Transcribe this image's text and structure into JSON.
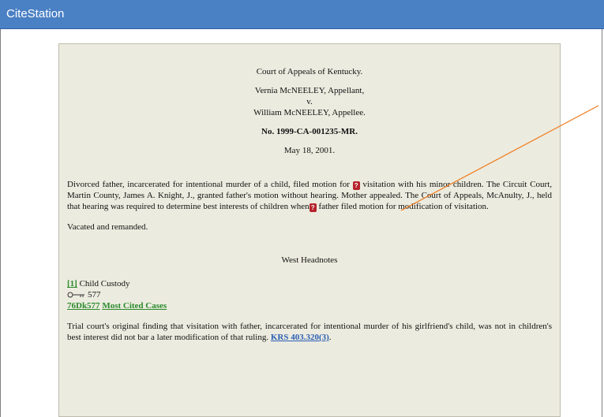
{
  "app": {
    "title": "CiteStation"
  },
  "case": {
    "court": "Court of Appeals of Kentucky.",
    "appellant": "Vernia McNEELEY, Appellant,",
    "versus": "v.",
    "appellee": "William McNEELEY, Appellee.",
    "number": "No. 1999-CA-001235-MR.",
    "date": "May 18, 2001."
  },
  "summary": {
    "part1": "Divorced father, incarcerated for intentional murder of a child, filed motion for",
    "part2": " visitation with his minor children. The Circuit Court, Martin County, James A. Knight, J., granted father's motion without hearing. Mother appealed. The Court of Appeals, McAnulty, J., held that hearing was required to determine best interests of children when",
    "part3": " father filed motion for modification of visitation.",
    "marker": "?"
  },
  "disposition": "Vacated and remanded.",
  "headnotes": {
    "heading": "West Headnotes",
    "items": [
      {
        "number": "[1]",
        "topic": "Child Custody",
        "key_number": "577",
        "key_icon": "key-number-icon",
        "citation": "76Dk577",
        "most_cited": "Most Cited Cases",
        "text": "Trial court's original finding that visitation with father, incarcerated for intentional murder of his girlfriend's child, was not in children's best interest did not bar a later modification of that ruling.",
        "statute_link": "KRS 403.320(3)",
        "after_link": "."
      }
    ]
  },
  "annotation": {
    "color": "#f07a1a"
  },
  "colors": {
    "titlebar": "#4a80c4",
    "doc_bg": "#ecebdf",
    "marker": "#b5222a",
    "green_link": "#2a8a2a",
    "blue_link": "#2b5fb5"
  }
}
